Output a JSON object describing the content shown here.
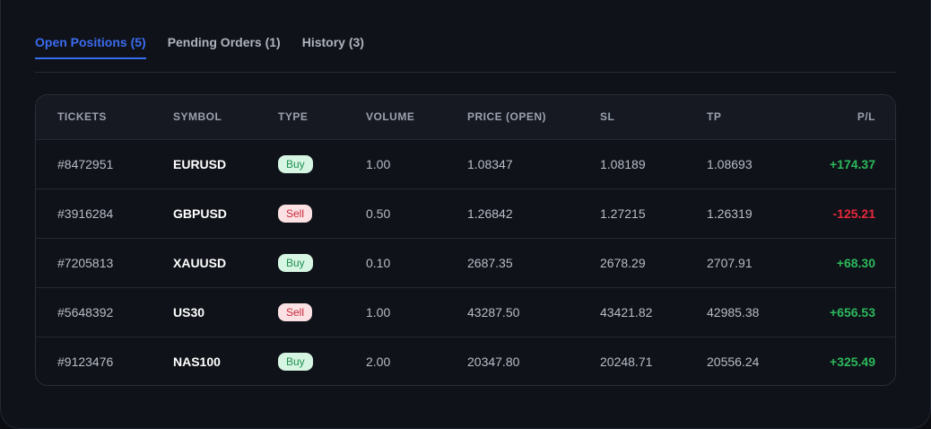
{
  "tabs": [
    {
      "label": "Open Positions (5)",
      "active": true
    },
    {
      "label": "Pending Orders (1)",
      "active": false
    },
    {
      "label": "History (3)",
      "active": false
    }
  ],
  "table": {
    "headers": [
      "TICKETS",
      "SYMBOL",
      "TYPE",
      "VOLUME",
      "PRICE (OPEN)",
      "SL",
      "TP",
      "P/L"
    ],
    "rows": [
      {
        "ticket": "#8472951",
        "symbol": "EURUSD",
        "type": "Buy",
        "volume": "1.00",
        "price": "1.08347",
        "sl": "1.08189",
        "tp": "1.08693",
        "pl": "+174.37"
      },
      {
        "ticket": "#3916284",
        "symbol": "GBPUSD",
        "type": "Sell",
        "volume": "0.50",
        "price": "1.26842",
        "sl": "1.27215",
        "tp": "1.26319",
        "pl": "-125.21"
      },
      {
        "ticket": "#7205813",
        "symbol": "XAUUSD",
        "type": "Buy",
        "volume": "0.10",
        "price": "2687.35",
        "sl": "2678.29",
        "tp": "2707.91",
        "pl": "+68.30"
      },
      {
        "ticket": "#5648392",
        "symbol": "US30",
        "type": "Sell",
        "volume": "1.00",
        "price": "43287.50",
        "sl": "43421.82",
        "tp": "42985.38",
        "pl": "+656.53"
      },
      {
        "ticket": "#9123476",
        "symbol": "NAS100",
        "type": "Buy",
        "volume": "2.00",
        "price": "20347.80",
        "sl": "20248.71",
        "tp": "20556.24",
        "pl": "+325.49"
      }
    ]
  },
  "colors": {
    "accent": "#3b6cf0",
    "profit": "#2db85c",
    "loss": "#e8283c",
    "buy_badge_bg": "#d6f5e3",
    "sell_badge_bg": "#fbe1e3"
  }
}
